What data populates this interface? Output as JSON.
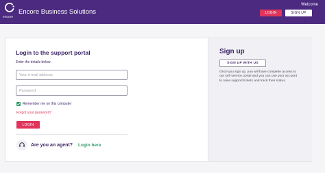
{
  "header": {
    "logo_word": "encore",
    "company_name": "Encore Business Solutions",
    "welcome_text": "Welcome",
    "login_label": "LOGIN",
    "signup_label": "SIGN UP"
  },
  "login": {
    "title": "Login to the support portal",
    "instructions": "Enter the details below",
    "email_placeholder": "Your e-mail address",
    "password_placeholder": "Password",
    "remember_label": "Remember me on this computer",
    "remember_checked": true,
    "forgot_label": "Forgot your password?",
    "login_button": "LOGIN",
    "agent_question": "Are you an agent?",
    "agent_login_link": "Login here"
  },
  "signup": {
    "title": "Sign up",
    "button_label": "SIGN UP WITH US",
    "description": "Once you sign up, you will have complete access to our self service portal and you can use your account to raise support tickets and track their status."
  },
  "colors": {
    "header_bg": "#4b2a7f",
    "accent_pink": "#e0345b",
    "accent_green": "#2f9c6a",
    "text_purple": "#3b2466"
  },
  "icons": {
    "logo": "encore-logo-icon",
    "checkbox": "check-icon",
    "agent": "headset-icon"
  }
}
